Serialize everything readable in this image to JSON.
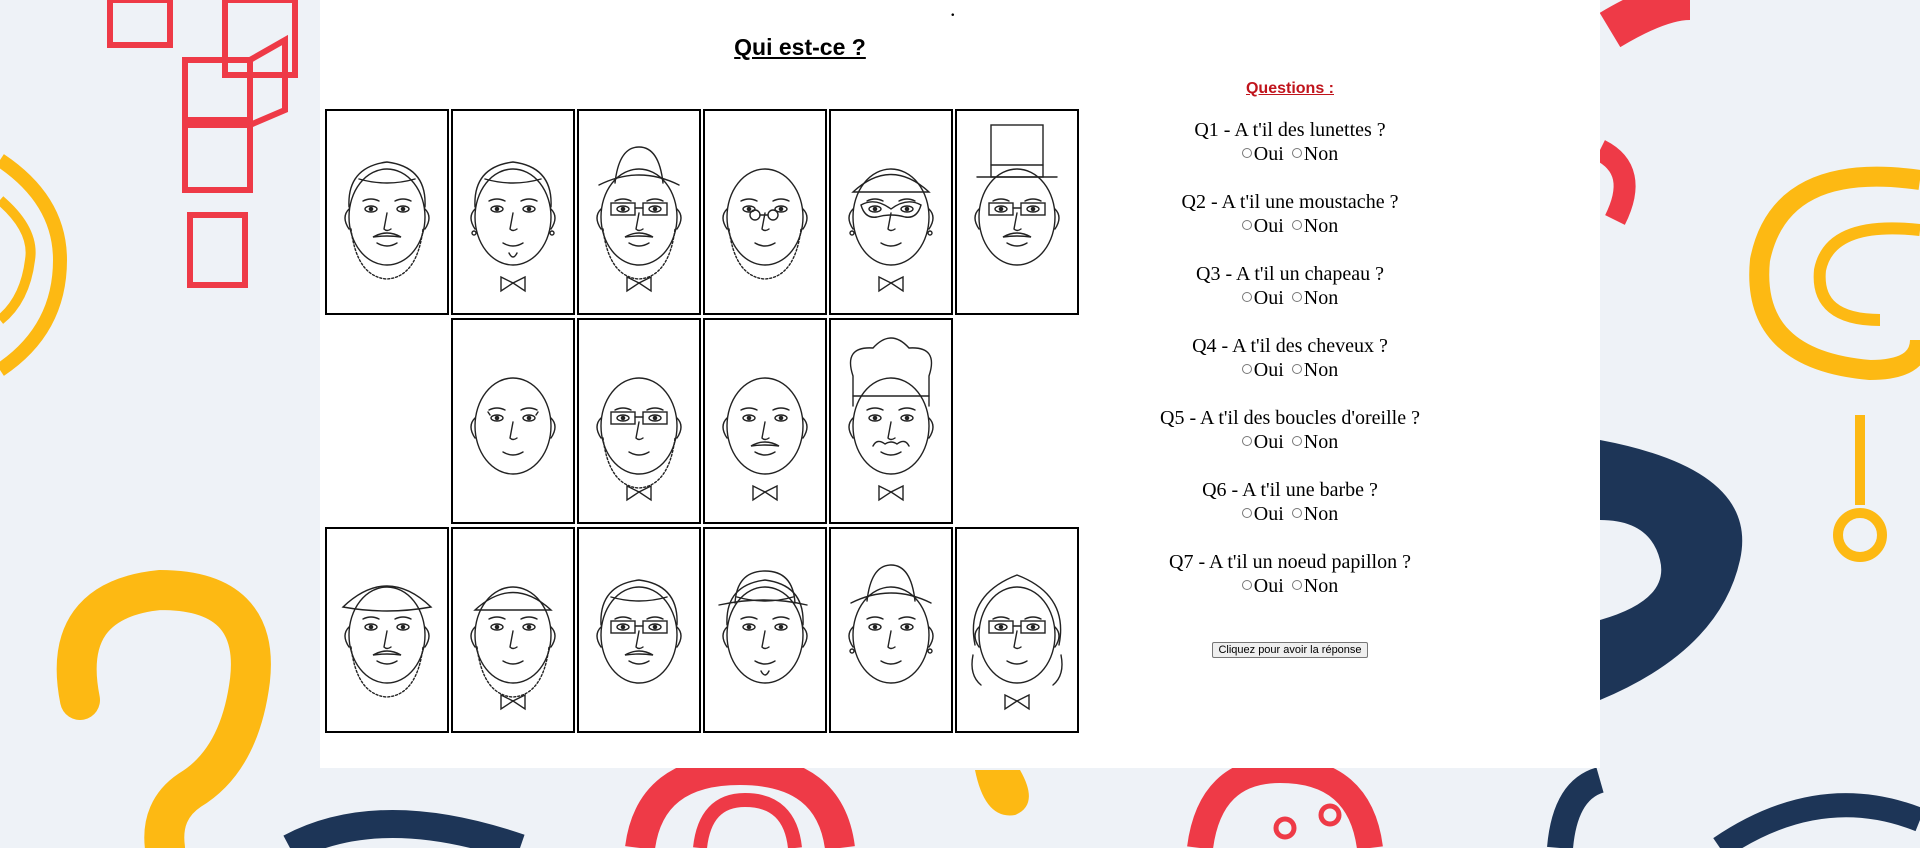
{
  "page": {
    "title": "Qui est-ce ?"
  },
  "board": {
    "cards": [
      {
        "id": "p1",
        "features": [
          "hair",
          "beard",
          "mustache"
        ]
      },
      {
        "id": "p2",
        "features": [
          "hair",
          "earrings",
          "bowtie",
          "goatee"
        ]
      },
      {
        "id": "p3",
        "features": [
          "hat",
          "glasses",
          "mustache",
          "beard",
          "bowtie"
        ]
      },
      {
        "id": "p4",
        "features": [
          "round-glasses",
          "beard"
        ]
      },
      {
        "id": "p5",
        "features": [
          "cap",
          "mask",
          "earrings",
          "bowtie"
        ]
      },
      {
        "id": "p6",
        "features": [
          "top-hat",
          "glasses",
          "mustache"
        ]
      },
      {
        "id": "empty1",
        "features": []
      },
      {
        "id": "p7",
        "features": [
          "bald",
          "eyelashes"
        ]
      },
      {
        "id": "p8",
        "features": [
          "bald",
          "glasses",
          "beard",
          "bowtie"
        ]
      },
      {
        "id": "p9",
        "features": [
          "bald",
          "mustache",
          "bowtie"
        ]
      },
      {
        "id": "p10",
        "features": [
          "chef-hat",
          "curly-mustache",
          "bowtie"
        ]
      },
      {
        "id": "empty2",
        "features": []
      },
      {
        "id": "p11",
        "features": [
          "beret",
          "beard",
          "mustache"
        ]
      },
      {
        "id": "p12",
        "features": [
          "cap",
          "beard",
          "bowtie"
        ]
      },
      {
        "id": "p13",
        "features": [
          "hair",
          "glasses",
          "mustache"
        ]
      },
      {
        "id": "p14",
        "features": [
          "bowler-hat",
          "hair",
          "goatee"
        ]
      },
      {
        "id": "p15",
        "features": [
          "hat",
          "earrings"
        ]
      },
      {
        "id": "p16",
        "features": [
          "curly-hair",
          "glasses",
          "bowtie"
        ]
      }
    ]
  },
  "questions": {
    "heading": "Questions :",
    "items": [
      {
        "label": "Q1 - A t'il des lunettes ?",
        "yes": "Oui",
        "no": "Non"
      },
      {
        "label": "Q2 - A t'il une moustache ?",
        "yes": "Oui",
        "no": "Non"
      },
      {
        "label": "Q3 - A t'il un chapeau ?",
        "yes": "Oui",
        "no": "Non"
      },
      {
        "label": "Q4 - A t'il des cheveux ?",
        "yes": "Oui",
        "no": "Non"
      },
      {
        "label": "Q5 - A t'il des boucles d'oreille ?",
        "yes": "Oui",
        "no": "Non"
      },
      {
        "label": "Q6 - A t'il une barbe ?",
        "yes": "Oui",
        "no": "Non"
      },
      {
        "label": "Q7 - A t'il un noeud papillon ?",
        "yes": "Oui",
        "no": "Non"
      }
    ],
    "submit_label": "Cliquez pour avoir la réponse"
  },
  "colors": {
    "heading": "#c0141c",
    "bg_red": "#ee3a47",
    "bg_yellow": "#fdb913",
    "bg_navy": "#1d3557"
  }
}
